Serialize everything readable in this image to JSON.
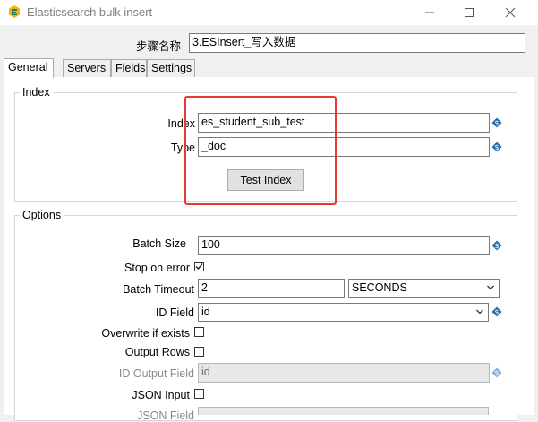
{
  "window": {
    "title": "Elasticsearch bulk insert",
    "controls": {
      "minimize": "–",
      "maximize": "☐",
      "close": "✕"
    }
  },
  "step_name": {
    "label": "步骤名称",
    "value": "3.ESInsert_写入数据"
  },
  "tabs": [
    {
      "label": "General",
      "active": true
    },
    {
      "label": "Servers",
      "active": false
    },
    {
      "label": "Fields",
      "active": false
    },
    {
      "label": "Settings",
      "active": false
    }
  ],
  "index_group": {
    "title": "Index",
    "index_label": "Index",
    "index_value": "es_student_sub_test",
    "type_label": "Type",
    "type_value": "_doc",
    "test_button": "Test Index"
  },
  "options_group": {
    "title": "Options",
    "batch_size_label": "Batch Size",
    "batch_size_value": "100",
    "stop_on_error_label": "Stop on error",
    "stop_on_error_checked": true,
    "batch_timeout_label": "Batch Timeout",
    "batch_timeout_value": "2",
    "timeout_unit": "SECONDS",
    "id_field_label": "ID Field",
    "id_field_value": "id",
    "overwrite_label": "Overwrite if exists",
    "overwrite_checked": false,
    "output_rows_label": "Output Rows",
    "output_rows_checked": false,
    "id_output_field_label": "ID Output Field",
    "id_output_field_value": "id",
    "json_input_label": "JSON Input",
    "json_input_checked": false,
    "json_field_label": "JSON Field",
    "json_field_value": ""
  },
  "colors": {
    "highlight_box": "#e53935",
    "variable_icon": "#1f6fb3"
  },
  "icons": {
    "app": "elasticsearch-icon",
    "variable": "variable-dollar-icon",
    "dropdown": "chevron-down-icon",
    "check": "check-icon"
  }
}
